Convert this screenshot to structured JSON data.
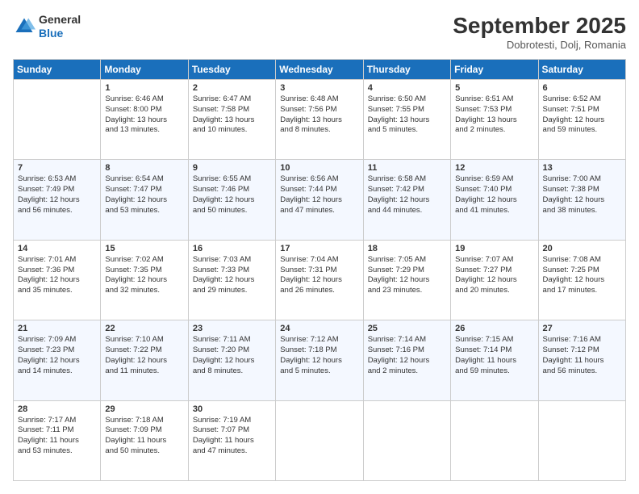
{
  "logo": {
    "line1": "General",
    "line2": "Blue"
  },
  "title": "September 2025",
  "subtitle": "Dobrotesti, Dolj, Romania",
  "headers": [
    "Sunday",
    "Monday",
    "Tuesday",
    "Wednesday",
    "Thursday",
    "Friday",
    "Saturday"
  ],
  "weeks": [
    [
      {
        "day": "",
        "info": ""
      },
      {
        "day": "1",
        "info": "Sunrise: 6:46 AM\nSunset: 8:00 PM\nDaylight: 13 hours\nand 13 minutes."
      },
      {
        "day": "2",
        "info": "Sunrise: 6:47 AM\nSunset: 7:58 PM\nDaylight: 13 hours\nand 10 minutes."
      },
      {
        "day": "3",
        "info": "Sunrise: 6:48 AM\nSunset: 7:56 PM\nDaylight: 13 hours\nand 8 minutes."
      },
      {
        "day": "4",
        "info": "Sunrise: 6:50 AM\nSunset: 7:55 PM\nDaylight: 13 hours\nand 5 minutes."
      },
      {
        "day": "5",
        "info": "Sunrise: 6:51 AM\nSunset: 7:53 PM\nDaylight: 13 hours\nand 2 minutes."
      },
      {
        "day": "6",
        "info": "Sunrise: 6:52 AM\nSunset: 7:51 PM\nDaylight: 12 hours\nand 59 minutes."
      }
    ],
    [
      {
        "day": "7",
        "info": "Sunrise: 6:53 AM\nSunset: 7:49 PM\nDaylight: 12 hours\nand 56 minutes."
      },
      {
        "day": "8",
        "info": "Sunrise: 6:54 AM\nSunset: 7:47 PM\nDaylight: 12 hours\nand 53 minutes."
      },
      {
        "day": "9",
        "info": "Sunrise: 6:55 AM\nSunset: 7:46 PM\nDaylight: 12 hours\nand 50 minutes."
      },
      {
        "day": "10",
        "info": "Sunrise: 6:56 AM\nSunset: 7:44 PM\nDaylight: 12 hours\nand 47 minutes."
      },
      {
        "day": "11",
        "info": "Sunrise: 6:58 AM\nSunset: 7:42 PM\nDaylight: 12 hours\nand 44 minutes."
      },
      {
        "day": "12",
        "info": "Sunrise: 6:59 AM\nSunset: 7:40 PM\nDaylight: 12 hours\nand 41 minutes."
      },
      {
        "day": "13",
        "info": "Sunrise: 7:00 AM\nSunset: 7:38 PM\nDaylight: 12 hours\nand 38 minutes."
      }
    ],
    [
      {
        "day": "14",
        "info": "Sunrise: 7:01 AM\nSunset: 7:36 PM\nDaylight: 12 hours\nand 35 minutes."
      },
      {
        "day": "15",
        "info": "Sunrise: 7:02 AM\nSunset: 7:35 PM\nDaylight: 12 hours\nand 32 minutes."
      },
      {
        "day": "16",
        "info": "Sunrise: 7:03 AM\nSunset: 7:33 PM\nDaylight: 12 hours\nand 29 minutes."
      },
      {
        "day": "17",
        "info": "Sunrise: 7:04 AM\nSunset: 7:31 PM\nDaylight: 12 hours\nand 26 minutes."
      },
      {
        "day": "18",
        "info": "Sunrise: 7:05 AM\nSunset: 7:29 PM\nDaylight: 12 hours\nand 23 minutes."
      },
      {
        "day": "19",
        "info": "Sunrise: 7:07 AM\nSunset: 7:27 PM\nDaylight: 12 hours\nand 20 minutes."
      },
      {
        "day": "20",
        "info": "Sunrise: 7:08 AM\nSunset: 7:25 PM\nDaylight: 12 hours\nand 17 minutes."
      }
    ],
    [
      {
        "day": "21",
        "info": "Sunrise: 7:09 AM\nSunset: 7:23 PM\nDaylight: 12 hours\nand 14 minutes."
      },
      {
        "day": "22",
        "info": "Sunrise: 7:10 AM\nSunset: 7:22 PM\nDaylight: 12 hours\nand 11 minutes."
      },
      {
        "day": "23",
        "info": "Sunrise: 7:11 AM\nSunset: 7:20 PM\nDaylight: 12 hours\nand 8 minutes."
      },
      {
        "day": "24",
        "info": "Sunrise: 7:12 AM\nSunset: 7:18 PM\nDaylight: 12 hours\nand 5 minutes."
      },
      {
        "day": "25",
        "info": "Sunrise: 7:14 AM\nSunset: 7:16 PM\nDaylight: 12 hours\nand 2 minutes."
      },
      {
        "day": "26",
        "info": "Sunrise: 7:15 AM\nSunset: 7:14 PM\nDaylight: 11 hours\nand 59 minutes."
      },
      {
        "day": "27",
        "info": "Sunrise: 7:16 AM\nSunset: 7:12 PM\nDaylight: 11 hours\nand 56 minutes."
      }
    ],
    [
      {
        "day": "28",
        "info": "Sunrise: 7:17 AM\nSunset: 7:11 PM\nDaylight: 11 hours\nand 53 minutes."
      },
      {
        "day": "29",
        "info": "Sunrise: 7:18 AM\nSunset: 7:09 PM\nDaylight: 11 hours\nand 50 minutes."
      },
      {
        "day": "30",
        "info": "Sunrise: 7:19 AM\nSunset: 7:07 PM\nDaylight: 11 hours\nand 47 minutes."
      },
      {
        "day": "",
        "info": ""
      },
      {
        "day": "",
        "info": ""
      },
      {
        "day": "",
        "info": ""
      },
      {
        "day": "",
        "info": ""
      }
    ]
  ]
}
